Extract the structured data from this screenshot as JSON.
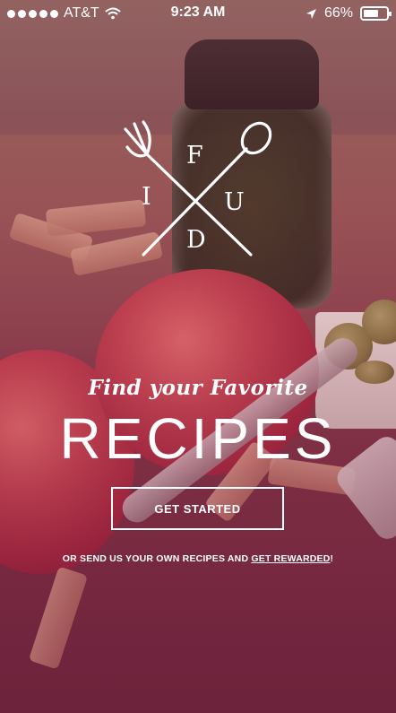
{
  "status_bar": {
    "carrier": "AT&T",
    "time": "9:23 AM",
    "battery": "66%",
    "battery_level": 0.66,
    "icons": [
      "signal-dots-icon",
      "wifi-icon",
      "location-arrow-icon",
      "battery-icon"
    ]
  },
  "logo": {
    "letters": {
      "top": "F",
      "left": "I",
      "right": "U",
      "bottom": "D"
    },
    "icons": [
      "fork-icon",
      "spoon-icon"
    ]
  },
  "hero": {
    "tagline": "Find your Favorite",
    "headline": "RECIPES"
  },
  "cta": {
    "label": "GET STARTED"
  },
  "footer": {
    "text": "OR SEND US YOUR OWN RECIPES AND",
    "link_label": "GET REWARDED",
    "suffix": "!"
  },
  "colors": {
    "text": "#ffffff",
    "overlay": "#8c2a4a"
  }
}
